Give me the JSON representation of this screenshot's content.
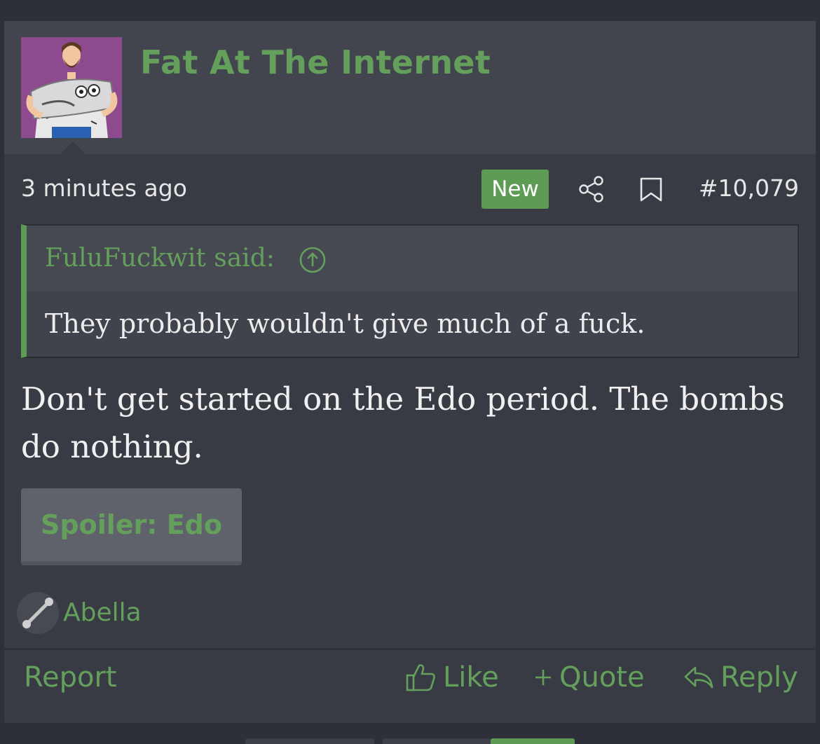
{
  "post": {
    "username": "Fat At The Internet",
    "avatar_icon": "user-avatar",
    "time": "3 minutes ago",
    "new_badge": "New",
    "post_number": "#10,079",
    "quote": {
      "author": "FuluFuckwit said:",
      "text": "They probably wouldn't give much of a fuck."
    },
    "message": "Don't get started on the Edo period. The bombs do nothing.",
    "spoiler_label": "Spoiler: Edo",
    "reaction": {
      "icon": "barbell-icon",
      "user": "Abella"
    },
    "actions": {
      "report": "Report",
      "like": "Like",
      "quote": "Quote",
      "reply": "Reply"
    }
  },
  "colors": {
    "accent": "#64a05c",
    "badge": "#5e9b55",
    "background": "#383b44",
    "header": "#42454e"
  }
}
